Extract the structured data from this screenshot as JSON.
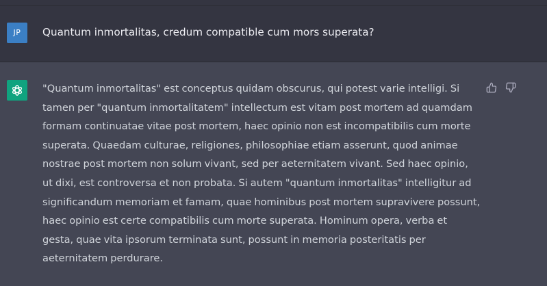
{
  "colors": {
    "user_avatar_bg": "#3b7fc4",
    "bot_avatar_bg": "#10a37f",
    "user_row_bg": "#343541",
    "assistant_row_bg": "#444654"
  },
  "user": {
    "avatar_initials": "JP",
    "message": "Quantum inmortalitas, credum compatible cum mors superata?"
  },
  "assistant": {
    "avatar_icon": "openai-logo-icon",
    "message": "\"Quantum inmortalitas\" est conceptus quidam obscurus, qui potest varie intelligi. Si tamen per \"quantum inmortalitatem\" intellectum est vitam post mortem ad quamdam formam continuatae vitae post mortem, haec opinio non est incompatibilis cum morte superata. Quaedam culturae, religiones, philosophiae etiam asserunt, quod animae nostrae post mortem non solum vivant, sed per aeternitatem vivant. Sed haec opinio, ut dixi, est controversa et non probata. Si autem \"quantum inmortalitas\" intelligitur ad significandum memoriam et famam, quae hominibus post mortem supravivere possunt, haec opinio est certe compatibilis cum morte superata. Hominum opera, verba et gesta, quae vita ipsorum terminata sunt, possunt in memoria posteritatis per aeternitatem perdurare.",
    "feedback_icons": [
      "thumbs-up-icon",
      "thumbs-down-icon"
    ]
  }
}
